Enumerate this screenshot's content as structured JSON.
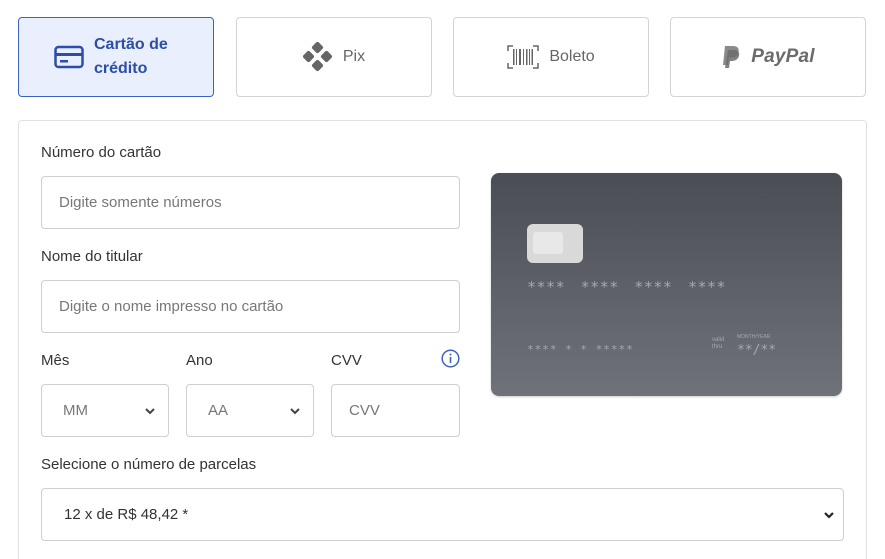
{
  "payment_methods": {
    "card": {
      "label": "Cartão de crédito",
      "icon": "credit-card-icon"
    },
    "pix": {
      "label": "Pix",
      "icon": "pix-icon"
    },
    "boleto": {
      "label": "Boleto",
      "icon": "barcode-icon"
    },
    "paypal": {
      "label": "PayPal",
      "icon": "paypal-icon"
    }
  },
  "form": {
    "card_number": {
      "label": "Número do cartão",
      "placeholder": "Digite somente números"
    },
    "holder_name": {
      "label": "Nome do titular",
      "placeholder": "Digite o nome impresso no cartão"
    },
    "month": {
      "label": "Mês",
      "value": "MM"
    },
    "year": {
      "label": "Ano",
      "value": "AA"
    },
    "cvv": {
      "label": "CVV",
      "placeholder": "CVV"
    },
    "installments": {
      "label": "Selecione o número de parcelas",
      "value": "12 x de R$ 48,42 *"
    }
  },
  "card_preview": {
    "number": "**** **** **** ****",
    "name": "**** * * *****",
    "valid_label": "valid thru",
    "until_label": "MONTH/YEAR",
    "expiry": "**/**"
  },
  "colors": {
    "accent": "#2c4da8",
    "active_bg": "#e9effc",
    "active_border": "#3a62c4",
    "info": "#3a62c4"
  }
}
